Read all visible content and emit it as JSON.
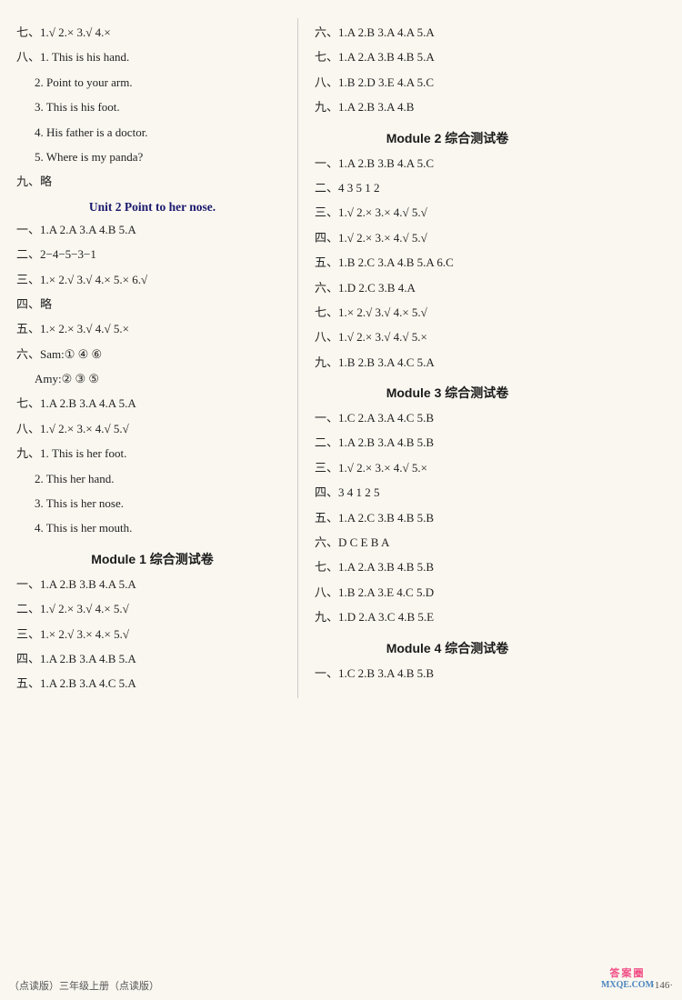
{
  "left": {
    "sections": [
      {
        "type": "line",
        "text": "七、1.√  2.×  3.√  4.×"
      },
      {
        "type": "line",
        "text": "八、1. This is his hand."
      },
      {
        "type": "line",
        "indent": 1,
        "text": "2. Point to your arm."
      },
      {
        "type": "line",
        "indent": 1,
        "text": "3. This is his foot."
      },
      {
        "type": "line",
        "indent": 1,
        "text": "4. His father is a doctor."
      },
      {
        "type": "line",
        "indent": 1,
        "text": "5. Where is my panda?"
      },
      {
        "type": "line",
        "text": "九、略"
      },
      {
        "type": "unit-title",
        "text": "Unit 2  Point to her nose."
      },
      {
        "type": "line",
        "text": "一、1.A  2.A  3.A  4.B  5.A"
      },
      {
        "type": "line",
        "text": "二、2−4−5−3−1"
      },
      {
        "type": "line",
        "text": "三、1.×  2.√  3.√  4.×  5.×  6.√"
      },
      {
        "type": "line",
        "text": "四、略"
      },
      {
        "type": "line",
        "text": "五、1.×  2.×  3.√  4.√  5.×"
      },
      {
        "type": "line",
        "text": "六、Sam:①  ④  ⑥"
      },
      {
        "type": "line",
        "indent": 1,
        "text": "Amy:②  ③  ⑤"
      },
      {
        "type": "line",
        "text": "七、1.A  2.B  3.A  4.A  5.A"
      },
      {
        "type": "line",
        "text": "八、1.√  2.×  3.×  4.√  5.√"
      },
      {
        "type": "line",
        "text": "九、1. This is her foot."
      },
      {
        "type": "line",
        "indent": 1,
        "text": "2. This her hand."
      },
      {
        "type": "line",
        "indent": 1,
        "text": "3. This is her nose."
      },
      {
        "type": "line",
        "indent": 1,
        "text": "4. This is her mouth."
      },
      {
        "type": "module-title",
        "text": "Module 1 综合测试卷"
      },
      {
        "type": "line",
        "text": "一、1.A  2.B  3.B  4.A  5.A"
      },
      {
        "type": "line",
        "text": "二、1.√  2.×  3.√  4.×  5.√"
      },
      {
        "type": "line",
        "text": "三、1.×  2.√  3.×  4.×  5.√"
      },
      {
        "type": "line",
        "text": "四、1.A  2.B  3.A  4.B  5.A"
      },
      {
        "type": "line",
        "text": "五、1.A  2.B  3.A  4.C  5.A"
      }
    ]
  },
  "right": {
    "sections": [
      {
        "type": "line",
        "text": "六、1.A  2.B  3.A  4.A  5.A"
      },
      {
        "type": "line",
        "text": "七、1.A  2.A  3.B  4.B  5.A"
      },
      {
        "type": "line",
        "text": "八、1.B  2.D  3.E  4.A  5.C"
      },
      {
        "type": "line",
        "text": "九、1.A  2.B  3.A  4.B"
      },
      {
        "type": "module-title",
        "text": "Module 2 综合测试卷"
      },
      {
        "type": "line",
        "text": "一、1.A  2.B  3.B  4.A  5.C"
      },
      {
        "type": "line",
        "text": "二、4  3  5  1  2"
      },
      {
        "type": "line",
        "text": "三、1.√  2.×  3.×  4.√  5.√"
      },
      {
        "type": "line",
        "text": "四、1.√  2.×  3.×  4.√  5.√"
      },
      {
        "type": "line",
        "text": "五、1.B  2.C  3.A  4.B  5.A  6.C"
      },
      {
        "type": "line",
        "text": "六、1.D  2.C  3.B  4.A"
      },
      {
        "type": "line",
        "text": "七、1.×  2.√  3.√  4.×  5.√"
      },
      {
        "type": "line",
        "text": "八、1.√  2.×  3.√  4.√  5.×"
      },
      {
        "type": "line",
        "text": "九、1.B  2.B  3.A  4.C  5.A"
      },
      {
        "type": "module-title",
        "text": "Module 3 综合测试卷"
      },
      {
        "type": "line",
        "text": "一、1.C  2.A  3.A  4.C  5.B"
      },
      {
        "type": "line",
        "text": "二、1.A  2.B  3.A  4.B  5.B"
      },
      {
        "type": "line",
        "text": "三、1.√  2.×  3.×  4.√  5.×"
      },
      {
        "type": "line",
        "text": "四、3  4  1  2  5"
      },
      {
        "type": "line",
        "text": "五、1.A  2.C  3.B  4.B  5.B"
      },
      {
        "type": "line",
        "text": "六、D  C  E  B  A"
      },
      {
        "type": "line",
        "text": "七、1.A  2.A  3.B  4.B  5.B"
      },
      {
        "type": "line",
        "text": "八、1.B  2.A  3.E  4.C  5.D"
      },
      {
        "type": "line",
        "text": "九、1.D  2.A  3.C  4.B  5.E"
      },
      {
        "type": "module-title",
        "text": "Module 4 综合测试卷"
      },
      {
        "type": "line",
        "text": "一、1.C  2.B  3.A  4.B  5.B"
      }
    ]
  },
  "footer": {
    "left": "（点读版）三年级上册（点读版）",
    "right": "·146·"
  },
  "watermark": {
    "line1": "答案圈",
    "line2": "MXQE.COM"
  }
}
